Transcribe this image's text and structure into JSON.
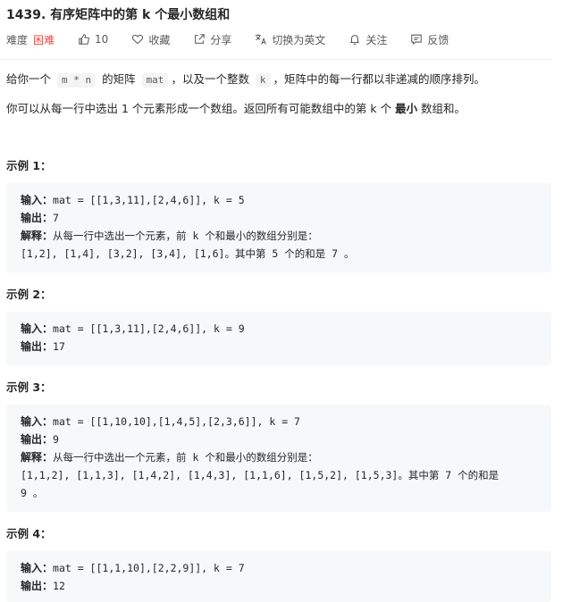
{
  "problem": {
    "title": "1439. 有序矩阵中的第 k 个最小数组和",
    "difficulty_label": "难度",
    "difficulty_value": "困难",
    "likes": "10",
    "favorite_label": "收藏",
    "share_label": "分享",
    "translate_label": "切换为英文",
    "follow_label": "关注",
    "feedback_label": "反馈"
  },
  "description": {
    "line1": {
      "a": "给你一个 ",
      "code1": "m * n",
      "b": " 的矩阵 ",
      "code2": "mat",
      "c": "，以及一个整数 ",
      "code3": "k",
      "d": "，矩阵中的每一行都以非递减的顺序排列。"
    },
    "line2": {
      "a": "你可以从每一行中选出 1 个元素形成一个数组。返回所有可能数组中的第 k 个 ",
      "bold": "最小",
      "b": " 数组和。"
    }
  },
  "examples": [
    {
      "title": "示例 1：",
      "lines": [
        {
          "label": "输入：",
          "text": "mat = [[1,3,11],[2,4,6]], k = 5"
        },
        {
          "label": "输出：",
          "text": "7"
        },
        {
          "label": "解释：",
          "text": "从每一行中选出一个元素，前 k 个和最小的数组分别是："
        },
        {
          "label": "",
          "text": "[1,2], [1,4], [3,2], [3,4], [1,6]。其中第 5 个的和是 7 。"
        }
      ]
    },
    {
      "title": "示例 2：",
      "lines": [
        {
          "label": "输入：",
          "text": "mat = [[1,3,11],[2,4,6]], k = 9"
        },
        {
          "label": "输出：",
          "text": "17"
        }
      ]
    },
    {
      "title": "示例 3：",
      "lines": [
        {
          "label": "输入：",
          "text": "mat = [[1,10,10],[1,4,5],[2,3,6]], k = 7"
        },
        {
          "label": "输出：",
          "text": "9"
        },
        {
          "label": "解释：",
          "text": "从每一行中选出一个元素，前 k 个和最小的数组分别是："
        },
        {
          "label": "",
          "text": "[1,1,2], [1,1,3], [1,4,2], [1,4,3], [1,1,6], [1,5,2], [1,5,3]。其中第 7 个的和是"
        },
        {
          "label": "",
          "text": "9 。"
        }
      ]
    },
    {
      "title": "示例 4：",
      "lines": [
        {
          "label": "输入：",
          "text": "mat = [[1,1,10],[2,2,9]], k = 7"
        },
        {
          "label": "输出：",
          "text": "12"
        }
      ]
    }
  ],
  "colors": {
    "difficulty_hard": "#ef4743",
    "example_bg": "#f7f8fa",
    "text": "#262626",
    "muted": "#595959"
  }
}
